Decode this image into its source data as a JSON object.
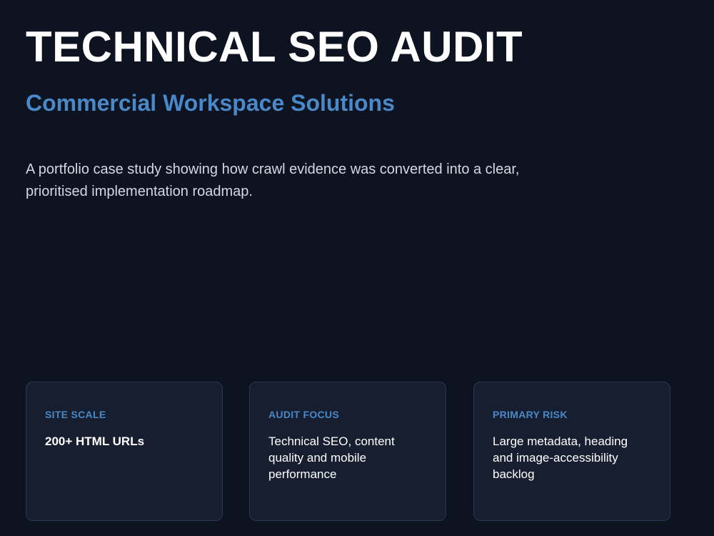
{
  "header": {
    "title": "TECHNICAL SEO AUDIT",
    "subtitle": "Commercial Workspace Solutions",
    "intro": "A portfolio case study showing how crawl evidence was converted into a clear, prioritised implementation roadmap."
  },
  "cards": [
    {
      "label": "SITE SCALE",
      "value": "200+ HTML URLs"
    },
    {
      "label": "AUDIT FOCUS",
      "value": "Technical SEO, content quality and mobile performance"
    },
    {
      "label": "PRIMARY RISK",
      "value": "Large metadata, heading and image-accessibility backlog"
    }
  ],
  "colors": {
    "background": "#0d1320",
    "accent": "#4a88c7",
    "card_background": "#161e30",
    "card_border": "#2c3852",
    "text": "#ffffff",
    "muted_text": "#d3d8e2"
  }
}
